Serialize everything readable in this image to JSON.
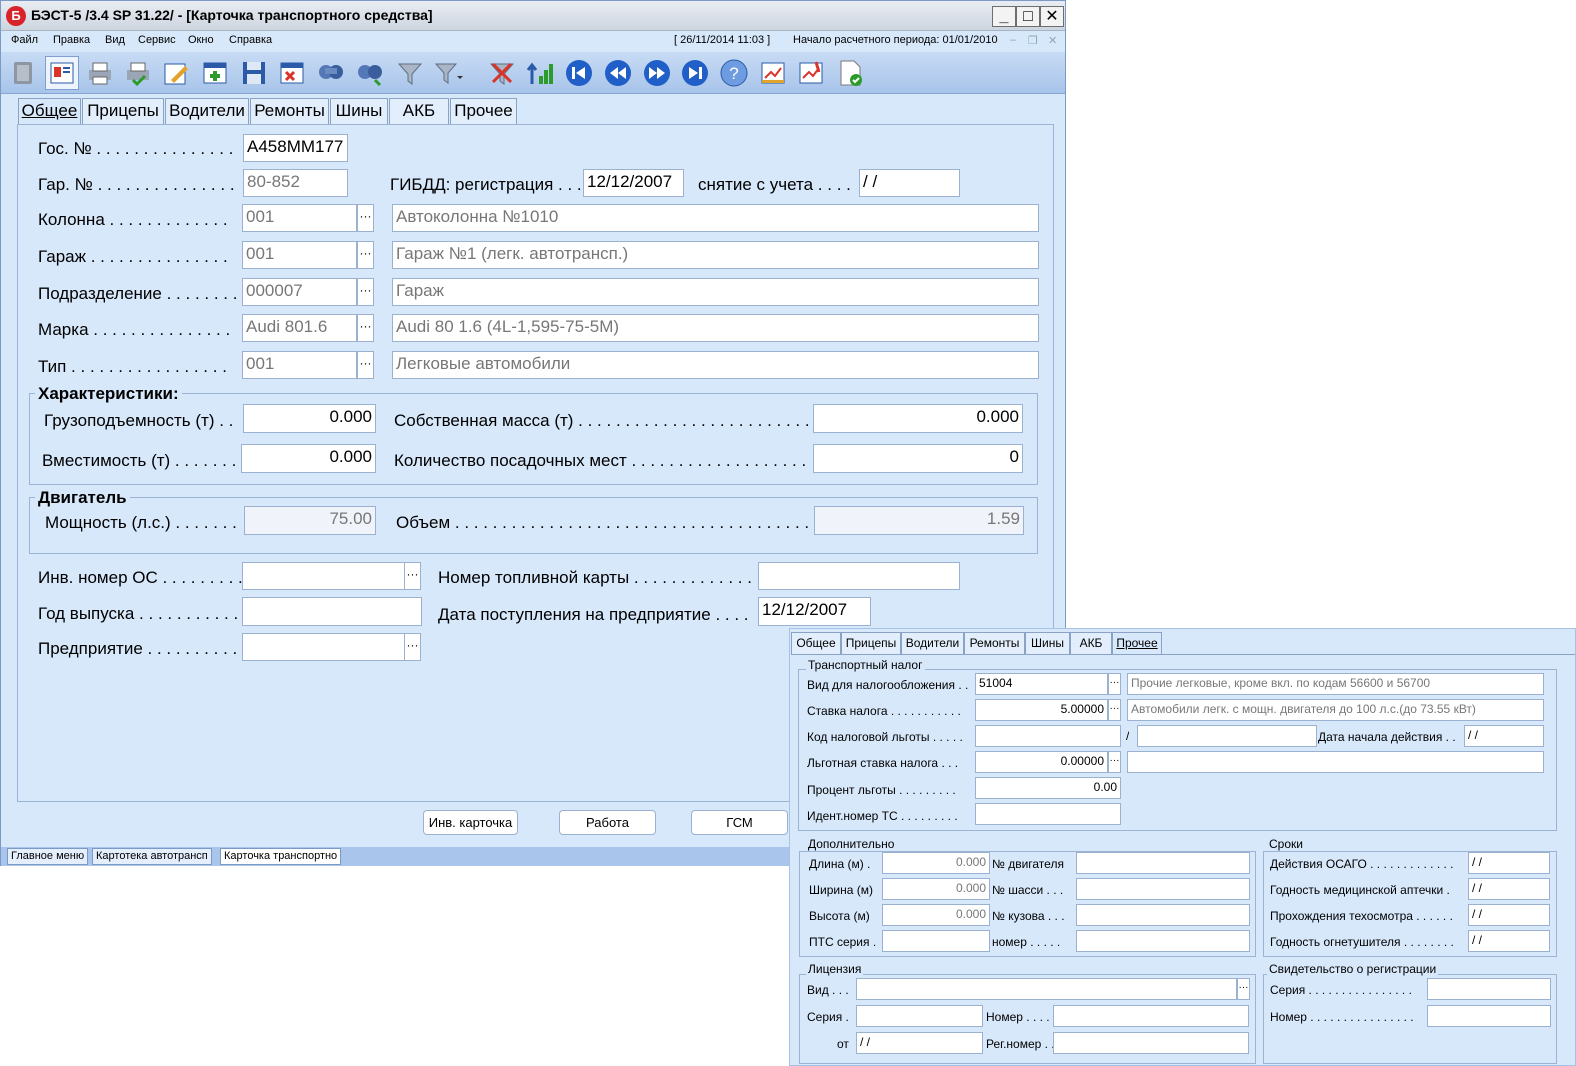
{
  "window": {
    "app_icon_letter": "Б",
    "title": "БЭСТ-5 /3.4 SP 31.22/ - [Карточка транспортного средства]",
    "minimize": "_",
    "maximize": "□",
    "close": "✕"
  },
  "menu": {
    "items": [
      "Файл",
      "Правка",
      "Вид",
      "Сервис",
      "Окно",
      "Справка"
    ],
    "datetime": "[ 26/11/2014 11:03 ]",
    "period": "Начало расчетного периода: 01/01/2010",
    "min": "–",
    "restore": "❐",
    "close": "✕"
  },
  "toolbar": {
    "icons": [
      "exit-icon",
      "vehicle-card-icon",
      "print-icon",
      "print-preview-icon",
      "edit-icon",
      "add-record-icon",
      "save-icon",
      "delete-record-icon",
      "search-icon",
      "search-next-icon",
      "filter-icon",
      "filter-dropdown-icon",
      "clear-filter-icon",
      "sort-icon",
      "first-record-icon",
      "previous-record-icon",
      "next-record-icon",
      "last-record-icon",
      "help-icon",
      "report-icon",
      "report-edit-icon",
      "document-check-icon"
    ]
  },
  "tabs": [
    "Общее",
    "Прицепы",
    "Водители",
    "Ремонты",
    "Шины",
    "АКБ",
    "Прочее"
  ],
  "form": {
    "gos_label": "Гос. № . . . . . . . . . . . . . . .",
    "gos_value": "А458ММ177",
    "gar_label": "Гар. № . . . . . . . . . . . . . . .",
    "gar_value": "80-852",
    "gibdd_label": "ГИБДД: регистрация . . .",
    "gibdd_value": "12/12/2007",
    "snyatie_label": "снятие с учета . . . .",
    "snyatie_value": " / /",
    "kolonna_label": "Колонна . . . . . . . . . . . . .",
    "kolonna_code": "001",
    "kolonna_name": "Автоколонна №1010",
    "garazh_label": "Гараж . . . . . . . . . . . . . . .",
    "garazh_code": "001",
    "garazh_name": "Гараж №1 (легк. автотрансп.)",
    "podr_label": "Подразделение . . . . . . . .",
    "podr_code": "000007",
    "podr_name": "Гараж",
    "marka_label": "Марка . . . . . . . . . . . . . . .",
    "marka_code": "Audi 801.6",
    "marka_name": "Audi 80 1.6 (4L-1,595-75-5M)",
    "tip_label": "Тип . . . . . . . . . . . . . . . . .",
    "tip_code": "001",
    "tip_name": "Легковые автомобили",
    "dots": "···"
  },
  "characteristics": {
    "title": "Характеристики:",
    "gruz_label": "Грузоподъемность (т) . .",
    "gruz_value": "0.000",
    "mass_label": "Собственная масса (т) . . . . . . . . . . . . . . . . . . . . . . . . . . . . .",
    "mass_value": "0.000",
    "vmest_label": "Вместимость (т) . . . . . . .",
    "vmest_value": "0.000",
    "seats_label": "Количество посадочных мест . . . . . . . . . . . . . . . . . . . . . . . .",
    "seats_value": "0"
  },
  "engine": {
    "title": "Двигатель",
    "power_label": "Мощность (л.с.) . . . . . . .",
    "power_value": "75.00",
    "volume_label": "Объем . . . . . . . . . . . . . . . . . . . . . . . . . . . . . . . . . . . . . . . . . . . . . .",
    "volume_value": "1.59"
  },
  "bottom": {
    "inv_label": "Инв. номер ОС . . . . . . . . .",
    "inv_value": "",
    "fuel_label": "Номер топливной карты . . . . . . . . . . . . . .",
    "fuel_value": "",
    "year_label": "Год выпуска . . . . . . . . . . .",
    "year_value": "",
    "date_label": "Дата поступления на предприятие . . . .",
    "date_value": "12/12/2007",
    "company_label": "Предприятие . . . . . . . . . .",
    "company_value": ""
  },
  "buttons": {
    "inv_card": "Инв. карточка",
    "work": "Работа",
    "gsm": "ГСМ"
  },
  "statusbar": [
    "Главное меню",
    "Картотека автотрансп",
    "Карточка транспортно"
  ],
  "window2": {
    "tabs": [
      "Общее",
      "Прицепы",
      "Водители",
      "Ремонты",
      "Шины",
      "АКБ",
      "Прочее"
    ],
    "tax": {
      "title": "Транспортный налог",
      "vid_label": "Вид для налогообложения . .",
      "vid_code": "51004",
      "vid_name": "Прочие легковые, кроме вкл. по кодам 56600 и 56700",
      "rate_label": "Ставка налога . . . . . . . . . . .",
      "rate_value": "5.00000",
      "rate_name": "Автомобили легк. с мощн. двигателя до 100 л.с.(до 73.55 кВт)",
      "code_label": "Код налоговой льготы . . . . .",
      "code_value": "",
      "slash": "/",
      "code_value2": "",
      "start_label": "Дата начала действия . .",
      "start_value": " / /",
      "lrate_label": "Льготная ставка налога . . .",
      "lrate_value": "0.00000",
      "lrate_name": "",
      "percent_label": "Процент льготы . . . . . . . . .",
      "percent_value": "0.00",
      "ident_label": "Идент.номер ТС . . . . . . . . .",
      "ident_value": ""
    },
    "extra": {
      "title": "Дополнительно",
      "len_label": "Длина (м) .",
      "len_value": "0.000",
      "engine_no_label": "№ двигателя",
      "engine_no_value": "",
      "wid_label": "Ширина (м)",
      "wid_value": "0.000",
      "chassis_label": "№ шасси . . .",
      "chassis_value": "",
      "hei_label": "Высота (м)",
      "hei_value": "0.000",
      "body_label": "№ кузова . . .",
      "body_value": "",
      "pts_label": "ПТС серия .",
      "pts_value": "",
      "number_label": "номер . . . . .",
      "number_value": ""
    },
    "terms": {
      "title": "Сроки",
      "osago_label": "Действия ОСАГО . . . . . . . . . . . . .",
      "osago_value": " / /",
      "med_label": "Годность медицинской аптечки .",
      "med_value": " / /",
      "to_label": "Прохождения техосмотра . . . . . .",
      "to_value": " / /",
      "fire_label": "Годность огнетушителя . . . . . . . .",
      "fire_value": " / /"
    },
    "license": {
      "title": "Лицензия",
      "vid_label": "Вид . . .",
      "vid_value": "",
      "ser_label": "Серия .",
      "ser_value": "",
      "num_label": "Номер . . . .",
      "num_value": "",
      "from_label": "от",
      "from_value": " / /",
      "reg_label": "Рег.номер . .",
      "reg_value": ""
    },
    "cert": {
      "title": "Свидетельство о регистрации",
      "ser_label": "Серия . . . . . . . . . . . . . . . .",
      "ser_value": "",
      "num_label": "Номер . . . . . . . . . . . . . . . .",
      "num_value": ""
    }
  }
}
